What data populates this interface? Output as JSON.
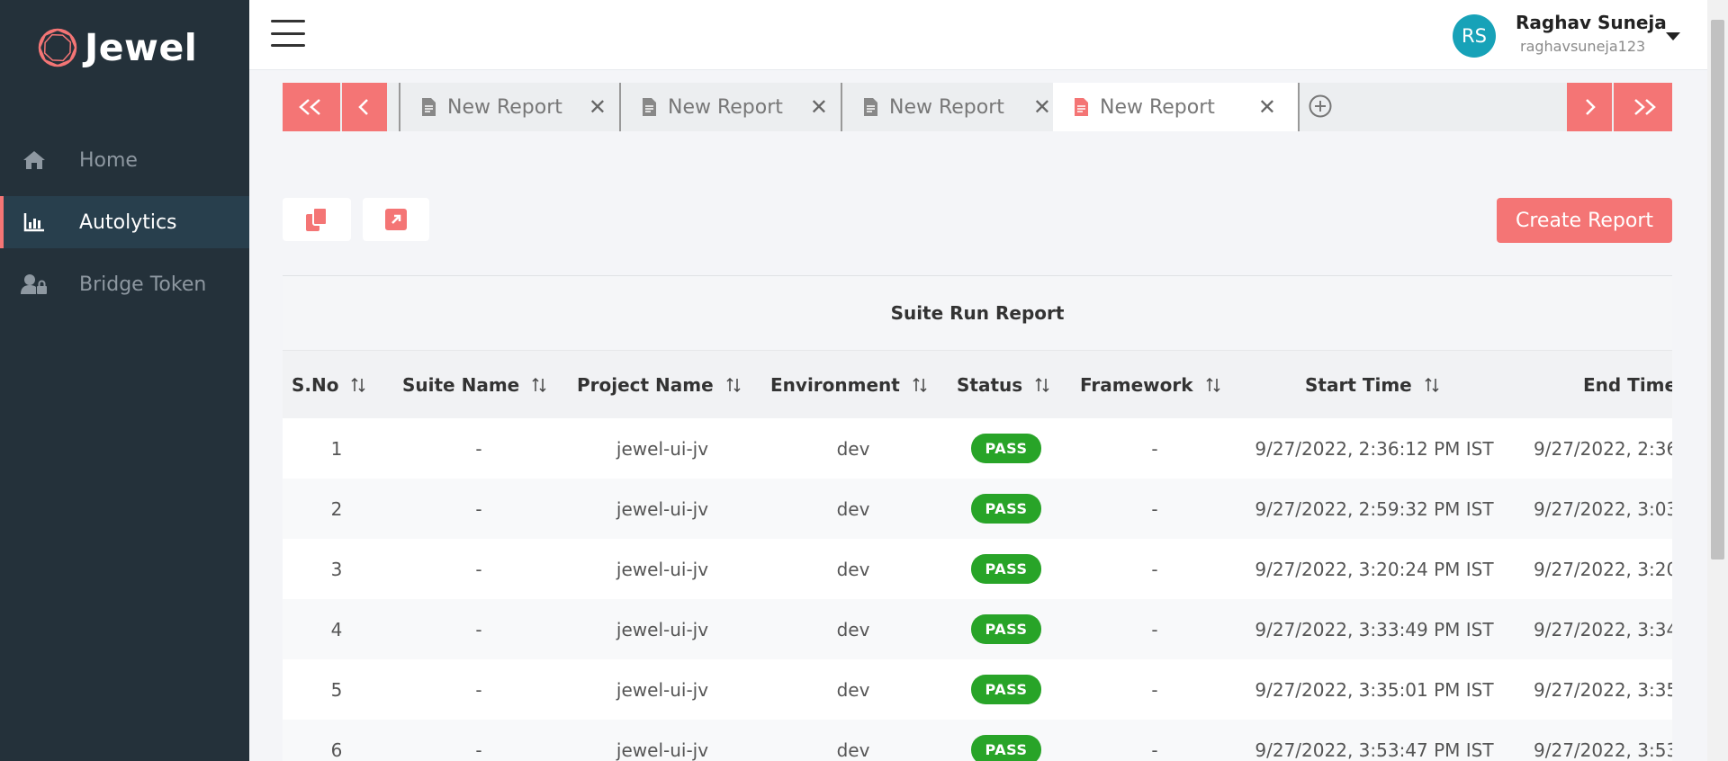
{
  "app": {
    "name": "Jewel"
  },
  "sidebar": {
    "items": [
      {
        "label": "Home",
        "icon": "home-icon",
        "active": false
      },
      {
        "label": "Autolytics",
        "icon": "bar-chart-icon",
        "active": true
      },
      {
        "label": "Bridge Token",
        "icon": "user-lock-icon",
        "active": false
      }
    ]
  },
  "user": {
    "initials": "RS",
    "name": "Raghav Suneja",
    "handle": "raghavsuneja123"
  },
  "tabs": [
    {
      "label": "New Report",
      "active": false
    },
    {
      "label": "New Report",
      "active": false
    },
    {
      "label": "New Report",
      "active": false
    },
    {
      "label": "New Report",
      "active": true
    }
  ],
  "nav": {
    "first": "<<",
    "prev": "<",
    "next": ">",
    "last": ">>"
  },
  "actions": {
    "create_label": "Create Report"
  },
  "report": {
    "title": "Suite Run Report",
    "columns": [
      "S.No",
      "Suite Name",
      "Project Name",
      "Environment",
      "Status",
      "Framework",
      "Start Time",
      "End Time"
    ],
    "rows": [
      [
        "1",
        "-",
        "jewel-ui-jv",
        "dev",
        "PASS",
        "-",
        "9/27/2022, 2:36:12 PM IST",
        "9/27/2022, 2:36"
      ],
      [
        "2",
        "-",
        "jewel-ui-jv",
        "dev",
        "PASS",
        "-",
        "9/27/2022, 2:59:32 PM IST",
        "9/27/2022, 3:03"
      ],
      [
        "3",
        "-",
        "jewel-ui-jv",
        "dev",
        "PASS",
        "-",
        "9/27/2022, 3:20:24 PM IST",
        "9/27/2022, 3:20"
      ],
      [
        "4",
        "-",
        "jewel-ui-jv",
        "dev",
        "PASS",
        "-",
        "9/27/2022, 3:33:49 PM IST",
        "9/27/2022, 3:34"
      ],
      [
        "5",
        "-",
        "jewel-ui-jv",
        "dev",
        "PASS",
        "-",
        "9/27/2022, 3:35:01 PM IST",
        "9/27/2022, 3:35"
      ],
      [
        "6",
        "-",
        "jewel-ui-jv",
        "dev",
        "PASS",
        "-",
        "9/27/2022, 3:53:47 PM IST",
        "9/27/2022, 3:53"
      ]
    ]
  },
  "colors": {
    "sidebar": "#24313a",
    "accent": "#f47575",
    "pass": "#28a428",
    "avatar": "#17a2b8"
  }
}
